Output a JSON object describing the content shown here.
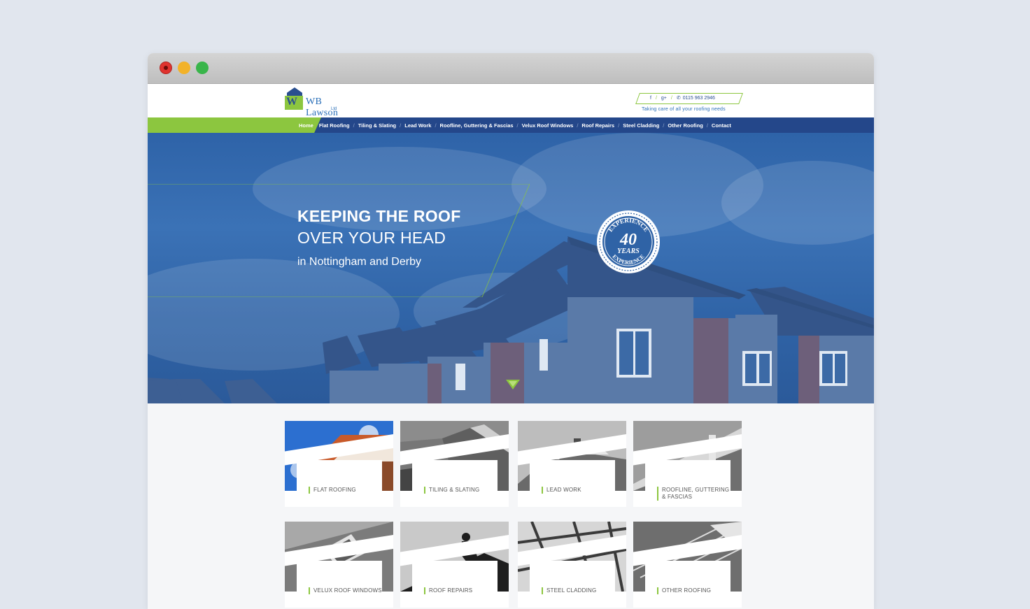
{
  "window": {
    "controls": [
      "close-dot",
      "minimize-dot",
      "maximize-dot"
    ]
  },
  "logo": {
    "name": "WB Lawson",
    "suffix": "Ltd"
  },
  "contact": {
    "facebook": "f",
    "google": "g+",
    "phone": "0115 963 2946",
    "tagline": "Taking care of all your roofing needs"
  },
  "nav": {
    "items": [
      "Home",
      "Flat Roofing",
      "Tiling & Slating",
      "Lead Work",
      "Roofline, Guttering & Fascias",
      "Velux Roof Windows",
      "Roof Repairs",
      "Steel Cladding",
      "Other Roofing",
      "Contact"
    ],
    "active": "Home"
  },
  "hero": {
    "line1": "KEEPING THE ROOF",
    "line2": "OVER YOUR HEAD",
    "line3": "in Nottingham and Derby",
    "badge_top": "EXPERIENCE",
    "badge_number": "40",
    "badge_years": "YEARS",
    "badge_bottom": "EXPERIENCE"
  },
  "services": [
    {
      "label": "FLAT ROOFING",
      "icon": "flat-roof-photo"
    },
    {
      "label": "TILING & SLATING",
      "icon": "tiling-photo"
    },
    {
      "label": "LEAD WORK",
      "icon": "lead-work-photo"
    },
    {
      "label": "ROOFLINE, GUTTERING & FASCIAS",
      "icon": "guttering-photo"
    },
    {
      "label": "VELUX ROOF WINDOWS",
      "icon": "velux-photo"
    },
    {
      "label": "ROOF REPAIRS",
      "icon": "roof-repair-photo"
    },
    {
      "label": "STEEL CLADDING",
      "icon": "steel-cladding-photo"
    },
    {
      "label": "OTHER ROOFING",
      "icon": "other-roofing-photo"
    }
  ],
  "colors": {
    "accent": "#8cc63f",
    "nav": "#24478a",
    "hero": "#2f63a6"
  }
}
